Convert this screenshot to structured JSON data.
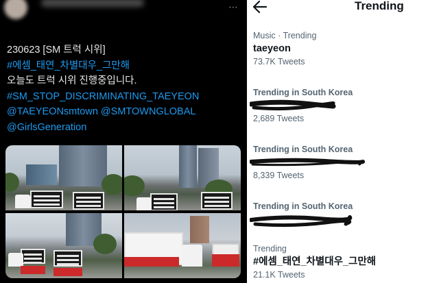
{
  "tweet": {
    "lines": [
      {
        "text": "230623 [SM 트럭 시위]",
        "kind": "plain"
      },
      {
        "text": "#에셈_태연_차별대우_그만해",
        "kind": "link"
      },
      {
        "text": "오늘도 트럭 시위 진행중입니다.",
        "kind": "plain"
      },
      {
        "text": "#SM_STOP_DISCRIMINATING_TAEYEON",
        "kind": "link"
      },
      {
        "text": "@TAEYEONsmtown @SMTOWNGLOBAL",
        "kind": "link"
      },
      {
        "text": "@GirlsGeneration",
        "kind": "link"
      }
    ],
    "photo_count": 4,
    "more_icon": "⋯"
  },
  "trending_page": {
    "title": "Trending",
    "back_icon": "arrow-left-icon",
    "items": [
      {
        "context": "Music · Trending",
        "topic": "taeyeon",
        "count": "73.7K Tweets"
      },
      {
        "context": "Trending in South Korea",
        "topic": "",
        "count": "2,689 Tweets"
      },
      {
        "context": "Trending in South Korea",
        "topic": "",
        "count": "8,339 Tweets"
      },
      {
        "context": "Trending in South Korea",
        "topic": "",
        "count": ""
      },
      {
        "context": "Trending",
        "topic": "#에셈_태연_차별대우_그만해",
        "count": "21.1K Tweets"
      }
    ]
  },
  "colors": {
    "link": "#1d9bf0",
    "dark_bg": "#000000",
    "light_bg": "#ffffff",
    "muted": "#536471",
    "scribble": "#111111"
  }
}
